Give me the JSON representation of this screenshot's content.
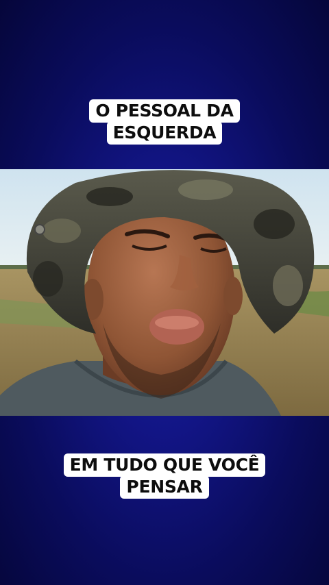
{
  "captions": {
    "top": [
      "O PESSOAL DA",
      "ESQUERDA"
    ],
    "bottom": [
      "EM TUDO QUE VOCÊ",
      "PENSAR"
    ]
  },
  "video": {
    "subject": "man-in-camouflage-bucket-hat-outdoors"
  },
  "colors": {
    "background_center": "#1a1f9e",
    "background_edge": "#05063a",
    "caption_bg": "#ffffff",
    "caption_text": "#0d0d0d"
  }
}
